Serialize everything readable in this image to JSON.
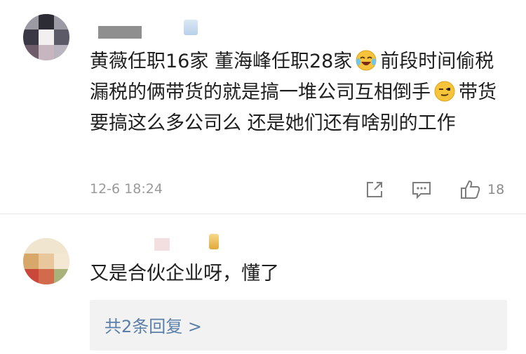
{
  "comments": [
    {
      "text_parts": [
        "黄薇任职16家 董海峰任职28家",
        "前段时间偷税漏税的俩带货的就是搞一堆公司互相倒手",
        "带货要搞这么多公司么 还是她们还有啥别的工作"
      ],
      "emojis": [
        "laugh-cry-emoji",
        "smirk-emoji"
      ],
      "timestamp": "12-6 18:24",
      "like_count": "18",
      "actions": [
        "share-icon",
        "comment-icon",
        "like-icon"
      ]
    },
    {
      "text": "又是合伙企业呀，懂了",
      "replies_link": "共2条回复 >"
    }
  ],
  "colors": {
    "text": "#1f1f1f",
    "meta": "#9a9a9a",
    "link": "#5a7fa8",
    "reply_bg": "#f2f2f2"
  }
}
